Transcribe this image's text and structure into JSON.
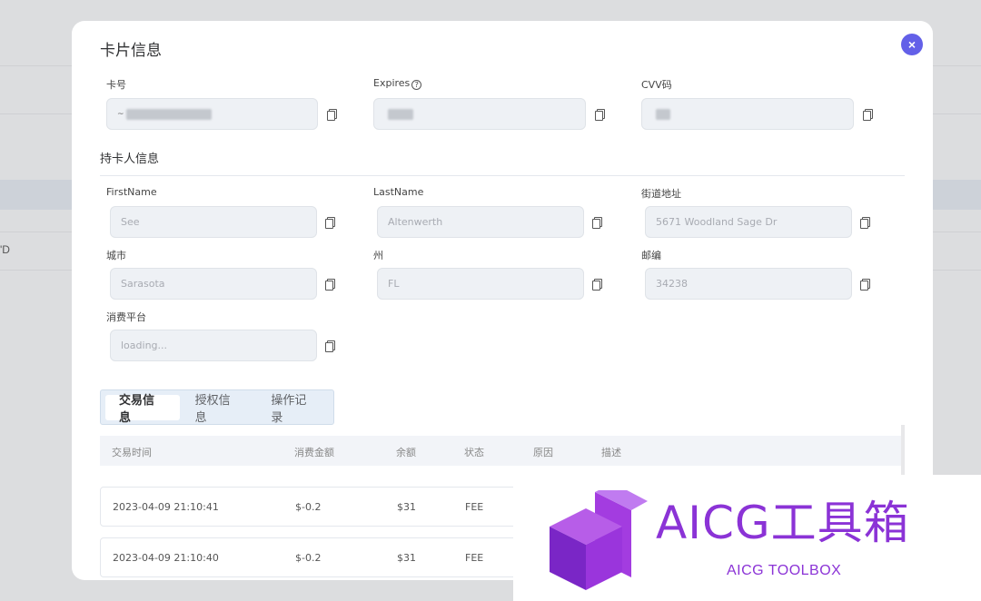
{
  "background": {
    "row_text": "'D"
  },
  "modal": {
    "title": "卡片信息",
    "close_label": "×"
  },
  "card": {
    "number_label": "卡号",
    "number_value": "~",
    "expires_label": "Expires",
    "cvv_label": "CVV码"
  },
  "holder": {
    "section_title": "持卡人信息",
    "first_name_label": "FirstName",
    "first_name_value": "See",
    "last_name_label": "LastName",
    "last_name_value": "Altenwerth",
    "street_label": "街道地址",
    "street_value": "5671 Woodland Sage Dr",
    "city_label": "城市",
    "city_value": "Sarasota",
    "state_label": "州",
    "state_value": "FL",
    "zip_label": "邮编",
    "zip_value": "34238",
    "platform_label": "消费平台",
    "platform_value": "loading..."
  },
  "tabs": [
    "交易信息",
    "授权信息",
    "操作记录"
  ],
  "table": {
    "columns": [
      "交易时间",
      "消费金额",
      "余额",
      "状态",
      "原因",
      "描述"
    ],
    "rows": [
      [
        "2023-04-09 21:10:41",
        "$-0.2",
        "$31",
        "FEE"
      ],
      [
        "2023-04-09 21:10:40",
        "$-0.2",
        "$31",
        "FEE"
      ]
    ]
  },
  "watermark": {
    "main": "AICG工具箱",
    "sub": "AICG TOOLBOX",
    "color": "#8b33d6"
  },
  "colors": {
    "accent": "#6360e8",
    "input_bg": "#eef1f5"
  }
}
